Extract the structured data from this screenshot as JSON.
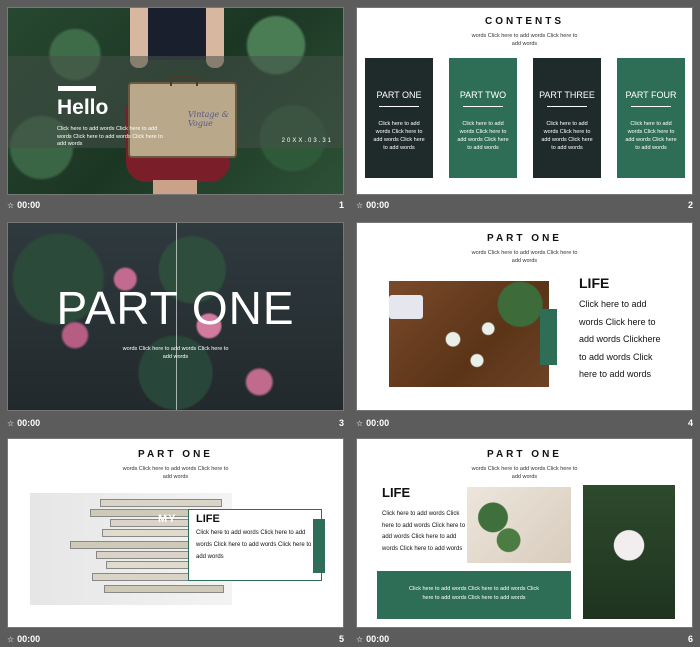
{
  "colors": {
    "accent_green": "#2e6e57",
    "dark_card": "#1f2a2a",
    "panel_bg": "#5c5c5c"
  },
  "icons": {
    "slide_marker": "star-icon"
  },
  "slides": [
    {
      "number": "1",
      "time": "00:00",
      "title": "Hello",
      "text": "Click here to add words Click here to add words Click here to add words Click here to add words",
      "date": "20XX.03.31",
      "suitcase_text": "Vintage & Vogue"
    },
    {
      "number": "2",
      "time": "00:00",
      "title": "CONTENTS",
      "subtitle": "words Click here to add words Click here to add words",
      "cards": [
        {
          "title": "PART ONE",
          "text": "Click here to add words Click here to add words Click here to add words"
        },
        {
          "title": "PART TWO",
          "text": "Click here to add words Click here to add words Click here to add words"
        },
        {
          "title": "PART THREE",
          "text": "Click here to add words Click here to add words Click here to add words"
        },
        {
          "title": "PART FOUR",
          "text": "Click here to add words Click here to add words Click here to add words"
        }
      ]
    },
    {
      "number": "3",
      "time": "00:00",
      "title": "PART ONE",
      "subtitle": "words Click here to add words Click here to add words"
    },
    {
      "number": "4",
      "time": "00:00",
      "title": "PART ONE",
      "subtitle": "words Click here to add words Click here to add words",
      "heading": "LIFE",
      "text": "Click here to add words Click here to add words Clickhere to add words Click here to add words"
    },
    {
      "number": "5",
      "time": "00:00",
      "title": "PART ONE",
      "subtitle": "words Click here to add words Click here to add words",
      "image_text": "MY",
      "heading": "LIFE",
      "text": "Click here to add words Click here to add words Click here to add words Click here to add words"
    },
    {
      "number": "6",
      "time": "00:00",
      "title": "PART ONE",
      "subtitle": "words Click here to add words Click here to add words",
      "heading": "LIFE",
      "text": "Click here to add words Click here to add words Click here to add words Click here to add words Click here to add words",
      "bar_text": "Click here to add words Click here to add words Click here to add words Click here to add words"
    }
  ]
}
